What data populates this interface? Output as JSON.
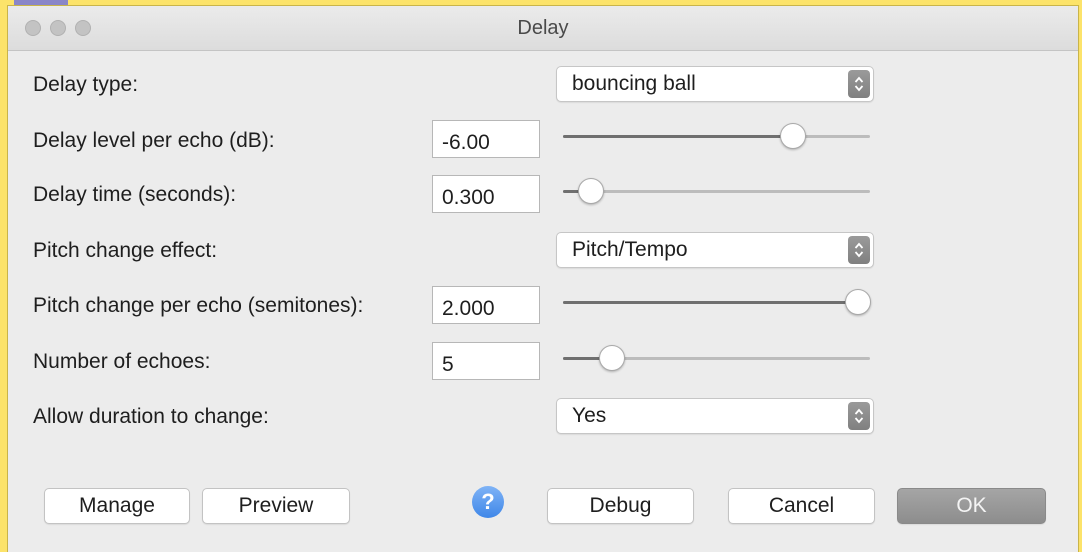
{
  "window": {
    "title": "Delay"
  },
  "rows": [
    {
      "label": "Delay type:",
      "control": "select",
      "value": "bouncing ball"
    },
    {
      "label": "Delay level per echo (dB):",
      "control": "text-slider",
      "value": "-6.00",
      "slider_fraction": 0.75
    },
    {
      "label": "Delay time (seconds):",
      "control": "text-slider",
      "value": "0.300",
      "slider_fraction": 0.09
    },
    {
      "label": "Pitch change effect:",
      "control": "select",
      "value": "Pitch/Tempo"
    },
    {
      "label": "Pitch change per echo (semitones):",
      "control": "text-slider",
      "value": "2.000",
      "slider_fraction": 0.96
    },
    {
      "label": "Number of echoes:",
      "control": "text-slider",
      "value": "5",
      "slider_fraction": 0.16
    },
    {
      "label": "Allow duration to change:",
      "control": "select",
      "value": "Yes"
    }
  ],
  "buttons": {
    "manage": "Manage",
    "preview": "Preview",
    "help": "?",
    "debug": "Debug",
    "cancel": "Cancel",
    "ok": "OK"
  },
  "icons": {
    "help": "question-mark-icon",
    "select_arrows": "up-down-chevron-icon"
  },
  "colors": {
    "background": "#fce36a",
    "window": "#ececec",
    "help_blue": "#4a8ff0",
    "ok_button": "#999999"
  }
}
